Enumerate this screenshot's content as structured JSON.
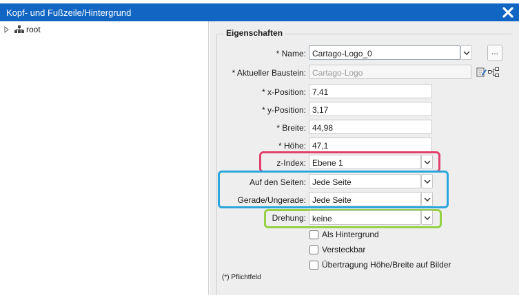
{
  "window": {
    "title": "Kopf- und Fußzeile/Hintergrund",
    "close_icon": "close-icon"
  },
  "tree": {
    "root_label": "root"
  },
  "properties": {
    "legend": "Eigenschaften",
    "name": {
      "label": "* Name:",
      "value": "Cartago-Logo_0",
      "more_button": "..."
    },
    "baustein": {
      "label": "* Aktueller Baustein:",
      "placeholder": "Cartago-Logo"
    },
    "x": {
      "label": "* x-Position:",
      "value": "7,41"
    },
    "y": {
      "label": "* y-Position:",
      "value": "3,17"
    },
    "breite": {
      "label": "* Breite:",
      "value": "44,98"
    },
    "hoehe": {
      "label": "* Höhe:",
      "value": "47,1"
    },
    "zindex": {
      "label": "z-Index:",
      "value": "Ebene 1"
    },
    "seiten": {
      "label": "Auf den Seiten:",
      "value": "Jede Seite"
    },
    "gerade": {
      "label": "Gerade/Ungerade:",
      "value": "Jede Seite"
    },
    "drehung": {
      "label": "Drehung:",
      "value": "keine"
    },
    "checkboxes": [
      "Als Hintergrund",
      "Versteckbar",
      "Übertragung Höhe/Breite auf Bilder"
    ],
    "footnote": "(*) Pflichtfeld"
  },
  "colors": {
    "titlebar": "#1166c4",
    "highlight_pink": "#e0406b",
    "highlight_blue": "#2ba6dc",
    "highlight_green": "#96d044"
  }
}
